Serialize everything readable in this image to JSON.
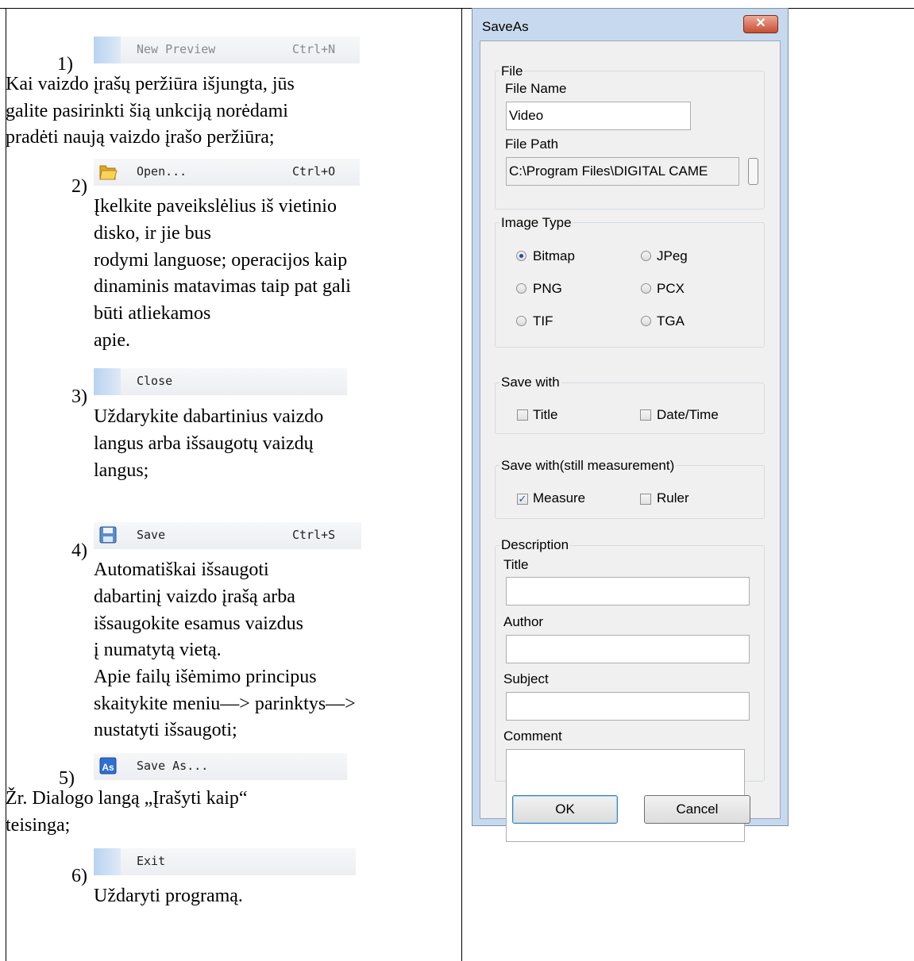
{
  "doc": {
    "items": [
      {
        "num": "1)",
        "menu": {
          "label": "New Preview",
          "shortcut": "Ctrl+N"
        },
        "text": [
          "Kai vaizdo įrašų peržiūra išjungta, jūs",
          "galite pasirinkti šią unkciją norėdami",
          "pradėti naują vaizdo įrašo peržiūra;"
        ]
      },
      {
        "num": "2)",
        "menu": {
          "label": "Open...",
          "shortcut": "Ctrl+O"
        },
        "text": [
          "Įkelkite paveikslėlius iš vietinio",
          "disko, ir jie bus",
          "rodymi languose; operacijos kaip",
          "dinaminis matavimas taip pat gali",
          "būti atliekamos",
          "apie."
        ]
      },
      {
        "num": "3)",
        "menu": {
          "label": "Close",
          "shortcut": ""
        },
        "text": [
          "Uždarykite dabartinius vaizdo",
          "langus arba išsaugotų vaizdų",
          "langus;"
        ]
      },
      {
        "num": "4)",
        "menu": {
          "label": "Save",
          "shortcut": "Ctrl+S"
        },
        "text": [
          "Automatiškai išsaugoti",
          "dabartinį vaizdo įrašą arba",
          "išsaugokite esamus vaizdus",
          "į numatytą vietą.",
          "Apie failų išėmimo principus",
          "skaitykite meniu—> parinktys—>",
          "nustatyti išsaugoti;"
        ]
      },
      {
        "num": "5)",
        "menu": {
          "label": "Save As...",
          "shortcut": ""
        },
        "text": [
          "Žr. Dialogo langą „Įrašyti kaip“",
          "teisinga;"
        ]
      },
      {
        "num": "6)",
        "menu": {
          "label": "Exit",
          "shortcut": ""
        },
        "text": [
          "Uždaryti programą."
        ]
      }
    ]
  },
  "dialog": {
    "title": "SaveAs",
    "file_group": "File",
    "file_name_label": "File Name",
    "file_name_value": "Video",
    "file_path_label": "File Path",
    "file_path_value": "C:\\Program Files\\DIGITAL CAME",
    "image_type_group": "Image Type",
    "image_types": [
      "Bitmap",
      "JPeg",
      "PNG",
      "PCX",
      "TIF",
      "TGA"
    ],
    "selected_image_type": "Bitmap",
    "save_with_group": "Save with",
    "save_with": [
      {
        "label": "Title",
        "checked": false
      },
      {
        "label": "Date/Time",
        "checked": false
      }
    ],
    "save_with_still_group": "Save with(still measurement)",
    "save_with_still": [
      {
        "label": "Measure",
        "checked": true
      },
      {
        "label": "Ruler",
        "checked": false
      }
    ],
    "description_group": "Description",
    "desc_title_label": "Title",
    "desc_author_label": "Author",
    "desc_subject_label": "Subject",
    "desc_comment_label": "Comment",
    "ok_label": "OK",
    "cancel_label": "Cancel"
  }
}
